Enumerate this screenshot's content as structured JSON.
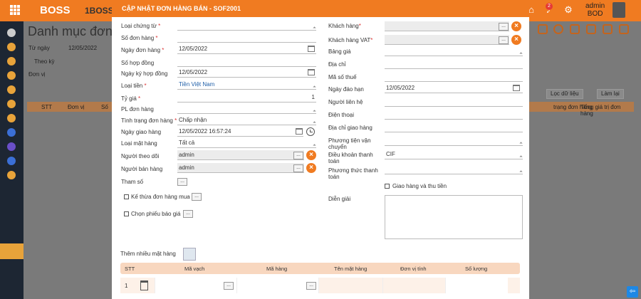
{
  "app": {
    "logo": "BOSS",
    "logo2": "1BOSS",
    "badge": "2",
    "user_name": "admin",
    "user_role": "BOD"
  },
  "background": {
    "title": "Danh mục đơn h",
    "from_date_label": "Từ ngày",
    "from_date": "12/05/2022",
    "period_label": "Theo kỳ",
    "unit_label": "Đơn vị",
    "filter_button": "Lọc dữ liệu",
    "refresh_button": "Làm lại",
    "columns": [
      "STT",
      "Đơn vị",
      "Số",
      "trạng đơn hàng",
      "Tổng giá trị đơn hàng"
    ]
  },
  "modal": {
    "title": "CẬP NHẬT ĐƠN HÀNG BÁN - SOF2001",
    "left": {
      "voucher_type_label": "Loại chứng từ",
      "order_no_label": "Số đơn hàng",
      "order_date_label": "Ngày đơn hàng",
      "order_date": "12/05/2022",
      "contract_no_label": "Số hợp đồng",
      "contract_date_label": "Ngày ký hợp đồng",
      "contract_date": "12/05/2022",
      "currency_label": "Loại tiền",
      "currency": "Tiền Việt Nam",
      "rate_label": "Tỷ giá",
      "rate": "1",
      "order_category_label": "PL đơn hàng",
      "status_label": "Tình trạng đơn hàng",
      "status": "Chấp nhận",
      "delivery_date_label": "Ngày giao hàng",
      "delivery_date": "12/05/2022 16:57:24",
      "item_type_label": "Loại mặt hàng",
      "item_type": "Tất cả",
      "follower_label": "Người theo dõi",
      "follower": "admin",
      "seller_label": "Người bán hàng",
      "seller": "admin",
      "params_label": "Tham số",
      "inherit_po_label": "Kế thừa đơn hàng mua",
      "choose_quote_label": "Chọn phiếu báo giá",
      "dots": "..."
    },
    "right": {
      "customer_label": "Khách hàng",
      "vat_customer_label": "Khách hàng VAT",
      "price_table_label": "Bảng giá",
      "address_label": "Địa chỉ",
      "tax_code_label": "Mã số thuế",
      "due_date_label": "Ngày đáo hạn",
      "due_date": "12/05/2022",
      "contact_label": "Người liên hệ",
      "phone_label": "Điện thoại",
      "delivery_address_label": "Địa chỉ giao hàng",
      "transport_label": "Phương tiện vận chuyển",
      "payment_terms_label": "Điều khoản thanh toán",
      "payment_terms": "CIF",
      "payment_method_label": "Phương thức thanh toán",
      "deliver_collect_label": "Giao hàng và thu tiền",
      "description_label": "Diễn giải"
    },
    "grid": {
      "add_items_label": "Thêm nhiều mặt hàng",
      "columns": [
        "STT",
        "Mã vạch",
        "Mã hàng",
        "Tên mặt hàng",
        "Đơn vị tính",
        "Số lượng"
      ],
      "row_no": "1"
    }
  }
}
